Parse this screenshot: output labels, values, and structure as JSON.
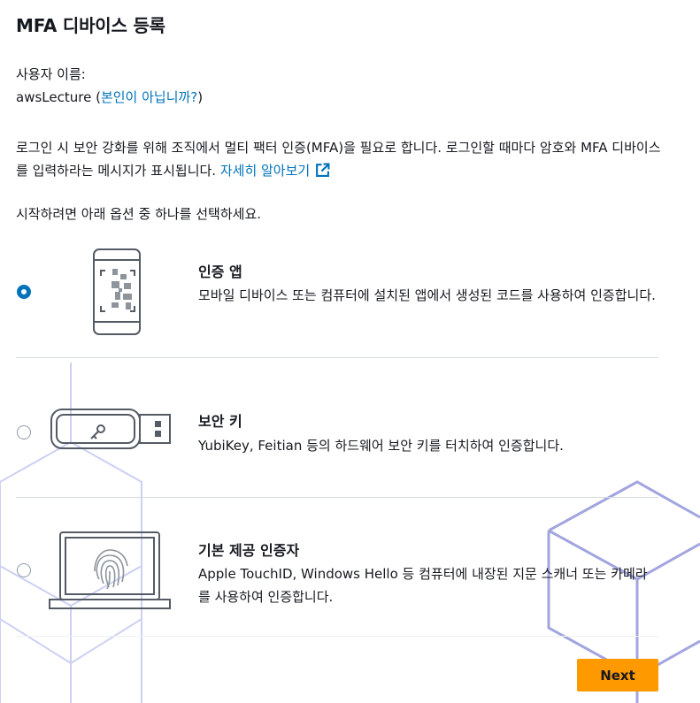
{
  "page": {
    "title": "MFA 디바이스 등록"
  },
  "user": {
    "label": "사용자 이름:",
    "name": "awsLecture",
    "open_paren": " (",
    "not_you_link": "본인이 아닙니까?",
    "close_paren": ")"
  },
  "intro": {
    "text": "로그인 시 보안 강화를 위해 조직에서 멀티 팩터 인증(MFA)을 필요로 합니다. 로그인할 때마다 암호와 MFA 디바이스를 입력하라는 메시지가 표시됩니다. ",
    "learn_more_link": "자세히 알아보기"
  },
  "choose_prompt": "시작하려면 아래 옵션 중 하나를 선택하세요.",
  "options": [
    {
      "title": "인증 앱",
      "description": "모바일 디바이스 또는 컴퓨터에 설치된 앱에서 생성된 코드를 사용하여 인증합니다.",
      "selected": true,
      "icon": "phone-qr-icon"
    },
    {
      "title": "보안 키",
      "description": "YubiKey, Feitian 등의 하드웨어 보안 키를 터치하여 인증합니다.",
      "selected": false,
      "icon": "usb-security-key-icon"
    },
    {
      "title": "기본 제공 인증자",
      "description": "Apple TouchID, Windows Hello 등 컴퓨터에 내장된 지문 스캐너 또는 카메라를 사용하여 인증합니다.",
      "selected": false,
      "icon": "laptop-fingerprint-icon"
    }
  ],
  "buttons": {
    "next": "Next"
  },
  "colors": {
    "accent": "#0073bb",
    "primary_button": "#ff9900",
    "divider": "#d5dbdb"
  }
}
